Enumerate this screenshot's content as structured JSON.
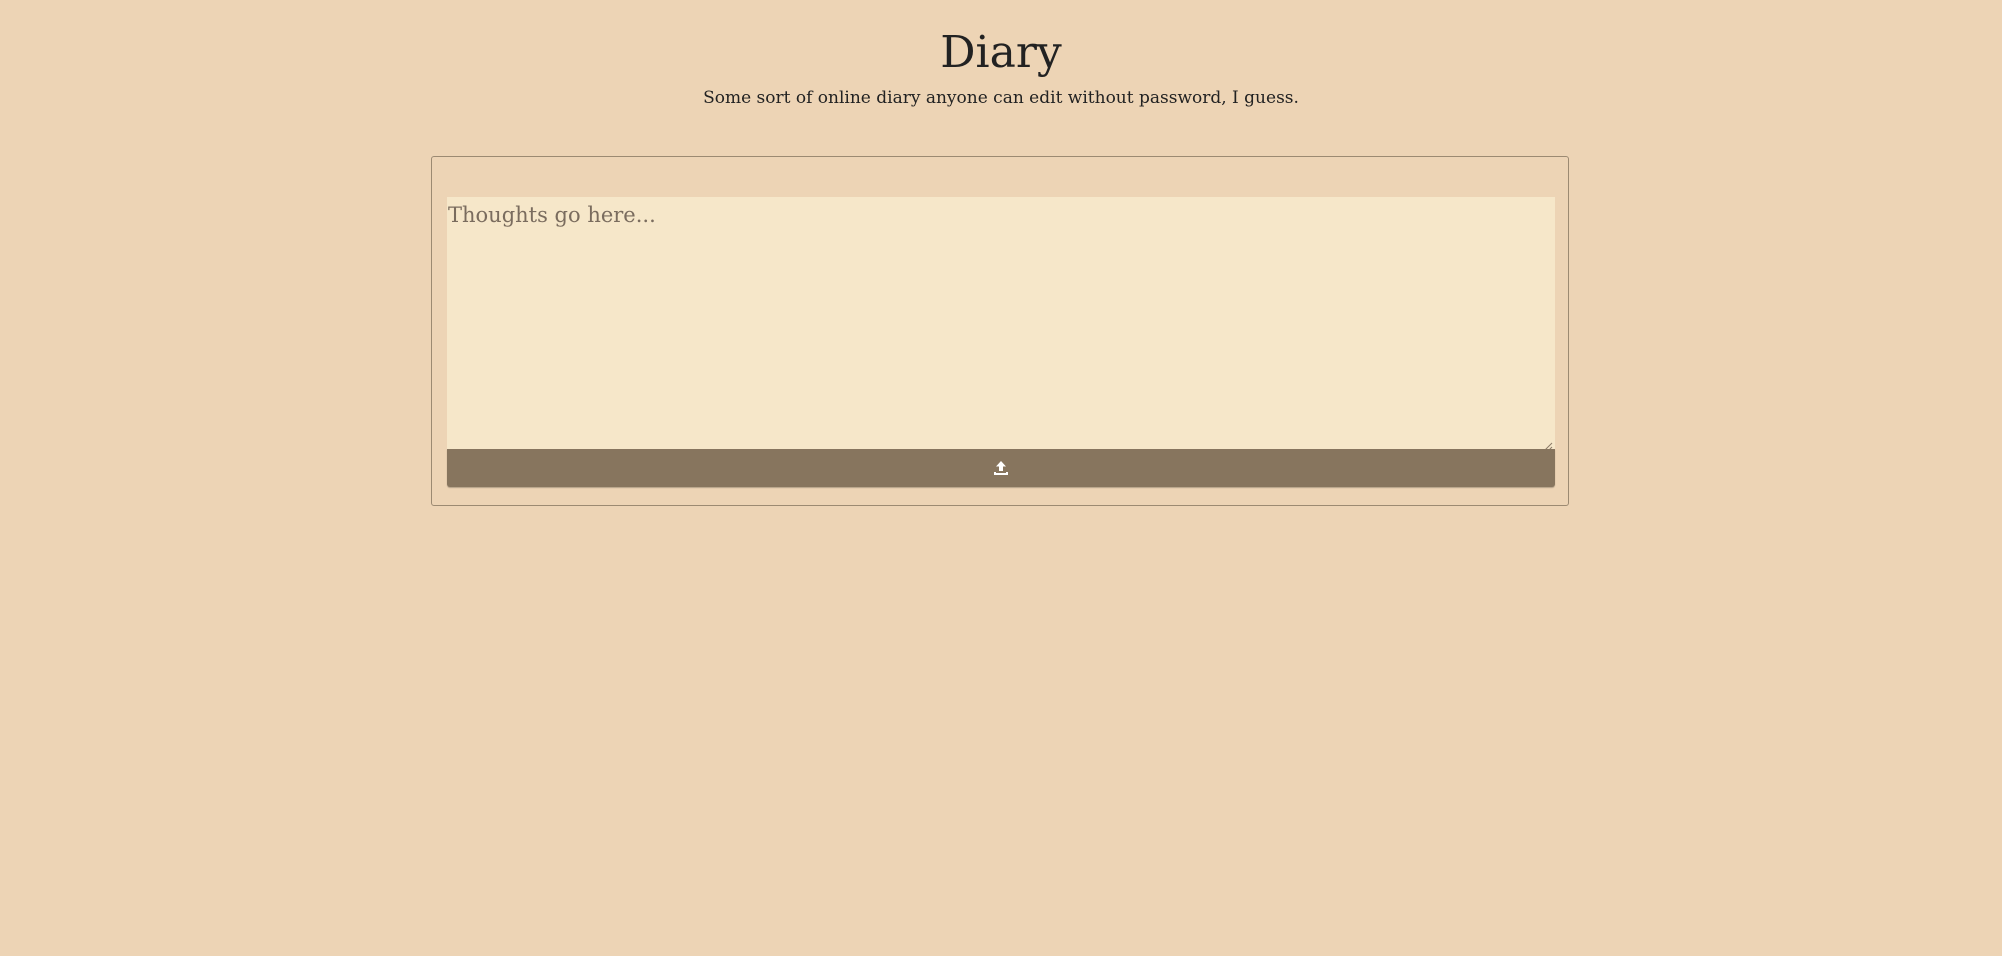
{
  "header": {
    "title": "Diary",
    "subtitle": "Some sort of online diary anyone can edit without password, I guess."
  },
  "entry": {
    "value": "",
    "placeholder": "Thoughts go here..."
  },
  "submit": {
    "icon": "upload-icon"
  },
  "colors": {
    "page_background": "#edd4b5",
    "textarea_background": "#f6e7c9",
    "button_background": "#87755e",
    "card_border": "#9c8a72",
    "text": "#222222"
  }
}
